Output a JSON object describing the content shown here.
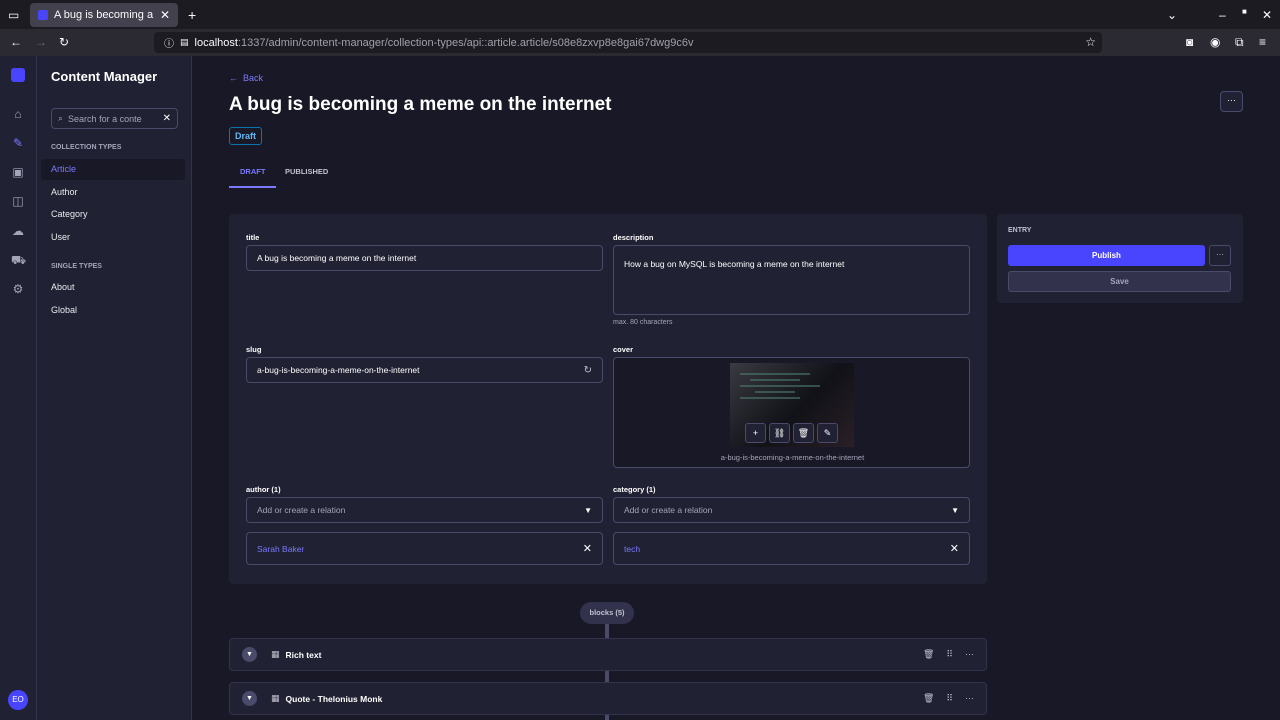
{
  "browser": {
    "tab_title": "A bug is becoming a meme on the internet",
    "url_host": "localhost",
    "url_path": ":1337/admin/content-manager/collection-types/api::article.article/s08e8zxvp8e8gai67dwg9c6v"
  },
  "subnav": {
    "title": "Content Manager",
    "search_placeholder": "Search for a conte",
    "collection_label": "COLLECTION TYPES",
    "collection_items": [
      "Article",
      "Author",
      "Category",
      "User"
    ],
    "single_label": "SINGLE TYPES",
    "single_items": [
      "About",
      "Global"
    ]
  },
  "user": {
    "initials": "EO"
  },
  "header": {
    "back": "Back",
    "title": "A bug is becoming a meme on the internet",
    "status": "Draft"
  },
  "tabs": [
    "DRAFT",
    "PUBLISHED"
  ],
  "form": {
    "title_label": "title",
    "title_value": "A bug is becoming a meme on the internet",
    "description_label": "description",
    "description_value": "How a bug on MySQL is becoming a meme on the internet",
    "description_hint": "max. 80 characters",
    "slug_label": "slug",
    "slug_value": "a-bug-is-becoming-a-meme-on-the-internet",
    "cover_label": "cover",
    "cover_filename": "a-bug-is-becoming-a-meme-on-the-internet",
    "author_label": "author (1)",
    "author_placeholder": "Add or create a relation",
    "author_value": "Sarah Baker",
    "category_label": "category (1)",
    "category_placeholder": "Add or create a relation",
    "category_value": "tech"
  },
  "entry": {
    "label": "ENTRY",
    "publish": "Publish",
    "save": "Save"
  },
  "blocks": {
    "label": "blocks (5)",
    "items": [
      "Rich text",
      "Quote - Thelonius Monk"
    ]
  },
  "colors": {
    "accent": "#4945ff",
    "link": "#7b79ff",
    "bg": "#181826",
    "surface": "#212134"
  }
}
